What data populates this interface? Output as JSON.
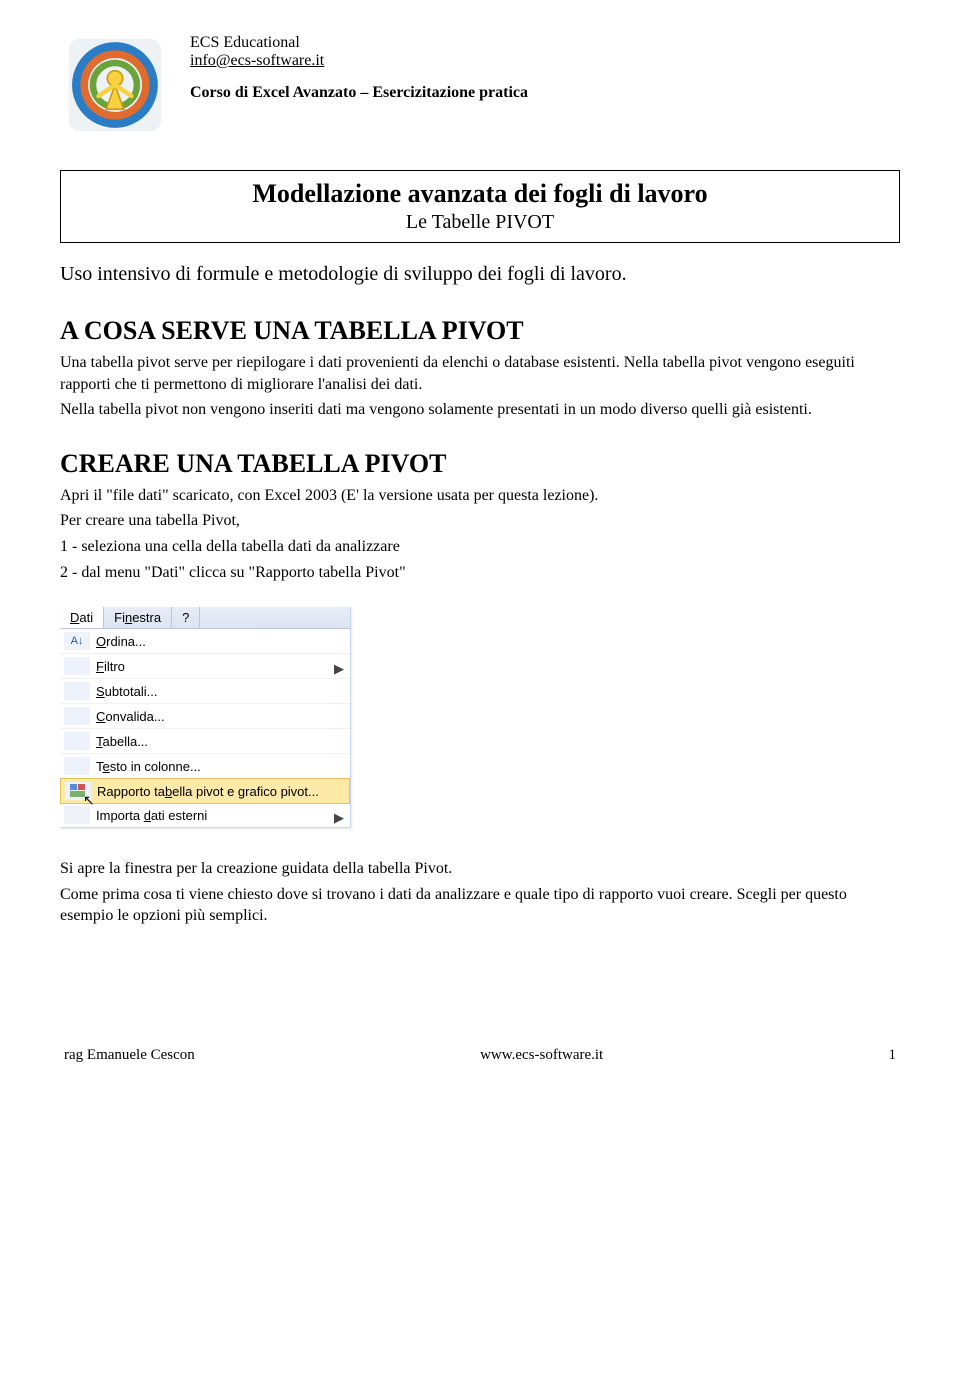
{
  "header": {
    "org": "ECS Educational",
    "email": "info@ecs-software.it",
    "course": "Corso di Excel Avanzato – Esercizitazione pratica"
  },
  "title": {
    "main": "Modellazione avanzata dei fogli di lavoro",
    "sub": "Le Tabelle PIVOT"
  },
  "intro": "Uso intensivo di formule e metodologie di sviluppo dei fogli di lavoro.",
  "section1": {
    "heading": "A COSA SERVE UNA TABELLA PIVOT",
    "p1": "Una tabella pivot serve per riepilogare i dati provenienti da elenchi o database esistenti. Nella tabella pivot vengono eseguiti rapporti che ti permettono di migliorare l'analisi dei dati.",
    "p2": "Nella tabella pivot non vengono inseriti dati ma vengono solamente presentati in un modo diverso quelli già esistenti."
  },
  "section2": {
    "heading": "CREARE UNA TABELLA PIVOT",
    "p1": "Apri il \"file dati\" scaricato, con Excel 2003 (E' la versione usata per questa lezione).",
    "p2": "Per creare una tabella Pivot,",
    "li1": "1 - seleziona una cella della tabella dati da analizzare",
    "li2": "2 - dal menu \"Dati\" clicca su \"Rapporto tabella Pivot\""
  },
  "menu": {
    "bar": {
      "dati": "Dati",
      "finestra": "Finestra",
      "help": "?"
    },
    "items": [
      {
        "icon": "A↓Z",
        "label": "Ordina...",
        "arrow": false
      },
      {
        "icon": "",
        "label": "Filtro",
        "arrow": true
      },
      {
        "icon": "",
        "label": "Subtotali...",
        "arrow": false
      },
      {
        "icon": "",
        "label": "Convalida...",
        "arrow": false
      },
      {
        "icon": "",
        "label": "Tabella...",
        "arrow": false
      },
      {
        "icon": "",
        "label": "Testo in colonne...",
        "arrow": false
      },
      {
        "icon": "📊",
        "label": "Rapporto tabella pivot e grafico pivot...",
        "arrow": false,
        "highlight": true,
        "cursor": true
      },
      {
        "icon": "",
        "label": "Importa dati esterni",
        "arrow": true
      }
    ]
  },
  "closing": {
    "p1": "Si apre la finestra per la creazione guidata della tabella Pivot.",
    "p2": "Come prima cosa ti viene chiesto dove si trovano i dati da analizzare e quale tipo di rapporto vuoi creare. Scegli per questo esempio le opzioni più semplici."
  },
  "footer": {
    "left": "rag Emanuele Cescon",
    "center": "www.ecs-software.it",
    "right": "1"
  }
}
